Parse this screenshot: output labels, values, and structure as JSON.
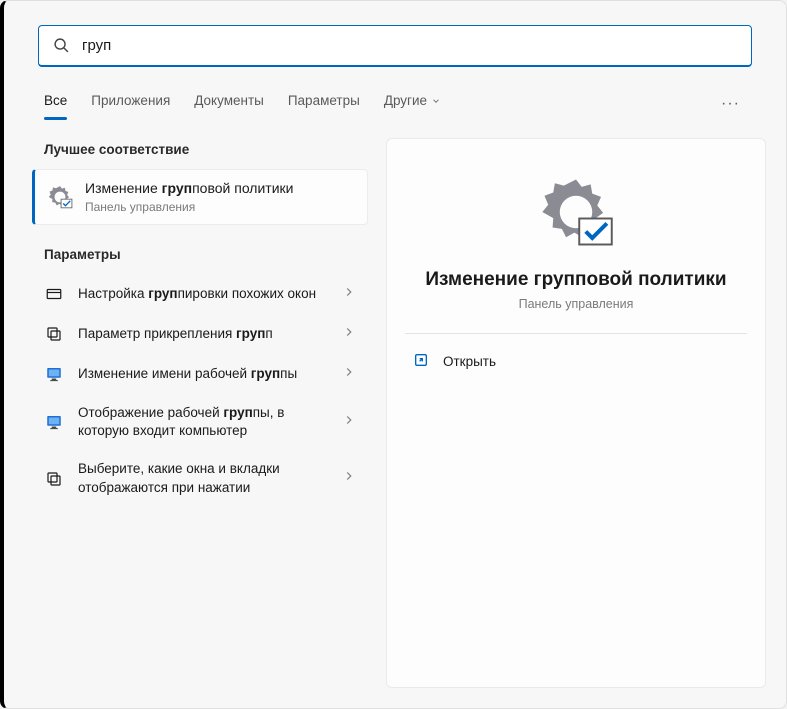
{
  "search": {
    "query": "груп"
  },
  "tabs": {
    "all": "Все",
    "apps": "Приложения",
    "docs": "Документы",
    "settings": "Параметры",
    "more": "Другие"
  },
  "sections": {
    "best": "Лучшее соответствие",
    "settings": "Параметры"
  },
  "bestMatch": {
    "title_pre": "Изменение ",
    "title_bold": "груп",
    "title_post": "повой политики",
    "subtitle": "Панель управления"
  },
  "settingsList": [
    {
      "pre": "Настройка ",
      "bold": "груп",
      "post": "пировки похожих окон",
      "icon": "window"
    },
    {
      "pre": "Параметр прикрепления ",
      "bold": "груп",
      "post": "п",
      "icon": "copy"
    },
    {
      "pre": "Изменение имени рабочей ",
      "bold": "груп",
      "post": "пы",
      "icon": "monitor"
    },
    {
      "pre": "Отображение рабочей ",
      "bold": "груп",
      "post": "пы, в которую входит компьютер",
      "icon": "monitor"
    },
    {
      "pre": "Выберите, какие окна и вкладки отображаются при нажатии",
      "bold": "",
      "post": "",
      "icon": "copy"
    }
  ],
  "preview": {
    "title": "Изменение групповой политики",
    "subtitle": "Панель управления",
    "actionOpen": "Открыть"
  }
}
